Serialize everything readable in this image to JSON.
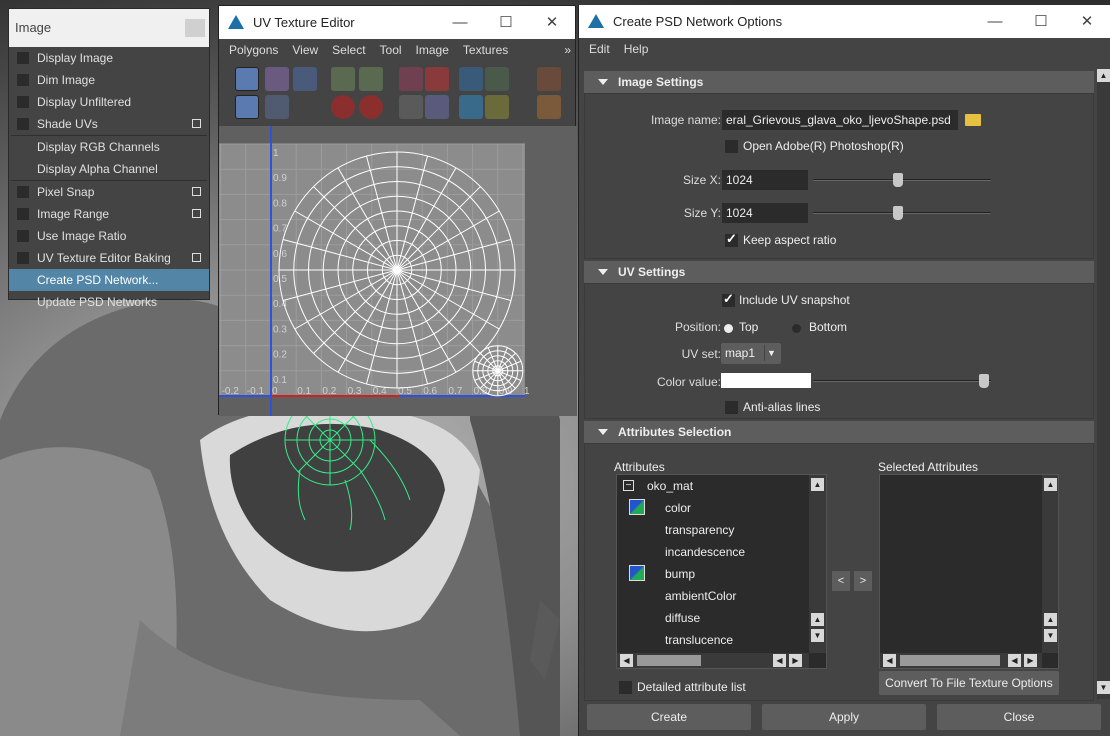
{
  "image_menu": {
    "title": "Image",
    "items": [
      {
        "label": "Display Image",
        "checkbox": true,
        "option": false
      },
      {
        "label": "Dim Image",
        "checkbox": true,
        "option": false
      },
      {
        "label": "Display Unfiltered",
        "checkbox": true,
        "option": false
      },
      {
        "label": "Shade UVs",
        "checkbox": true,
        "option": true
      },
      {
        "label": "Display RGB Channels",
        "checkbox": false,
        "option": false
      },
      {
        "label": "Display Alpha Channel",
        "checkbox": false,
        "option": false
      },
      {
        "label": "Pixel Snap",
        "checkbox": true,
        "option": true
      },
      {
        "label": "Image Range",
        "checkbox": true,
        "option": true
      },
      {
        "label": "Use Image Ratio",
        "checkbox": true,
        "option": false
      },
      {
        "label": "UV Texture Editor Baking",
        "checkbox": true,
        "option": true
      },
      {
        "label": "Create PSD Network...",
        "checkbox": false,
        "option": false,
        "selected": true
      },
      {
        "label": "Update PSD Networks",
        "checkbox": false,
        "option": false
      }
    ]
  },
  "uv_editor": {
    "title": "UV Texture Editor",
    "menus": [
      "Polygons",
      "View",
      "Select",
      "Tool",
      "Image",
      "Textures"
    ],
    "overflow": "»",
    "y_ticks": [
      "1",
      "0.9",
      "0.8",
      "0.7",
      "0.6",
      "0.5",
      "0.4",
      "0.3",
      "0.2",
      "0.1"
    ],
    "x_ticks": [
      "-0.2",
      "-0.1",
      "0",
      "0.1",
      "0.2",
      "0.3",
      "0.4",
      "0.5",
      "0.6",
      "0.7",
      "0.8",
      "0.9",
      "1"
    ]
  },
  "psd_window": {
    "title": "Create PSD Network Options",
    "menus": [
      "Edit",
      "Help"
    ],
    "image_settings": {
      "header": "Image Settings",
      "image_name_label": "Image name:",
      "image_name_value": "eral_Grievous_glava_oko_ljevoShape.psd",
      "open_photoshop_label": "Open Adobe(R) Photoshop(R)",
      "open_photoshop_checked": false,
      "size_x_label": "Size X:",
      "size_x_value": "1024",
      "size_y_label": "Size Y:",
      "size_y_value": "1024",
      "keep_aspect_label": "Keep aspect ratio",
      "keep_aspect_checked": true
    },
    "uv_settings": {
      "header": "UV Settings",
      "include_snapshot_label": "Include UV snapshot",
      "include_snapshot_checked": true,
      "position_label": "Position:",
      "position_options": [
        "Top",
        "Bottom"
      ],
      "position_selected": "Top",
      "uv_set_label": "UV set:",
      "uv_set_value": "map1",
      "color_value_label": "Color value:",
      "color_value": "#ffffff",
      "anti_alias_label": "Anti-alias lines",
      "anti_alias_checked": false
    },
    "attributes_selection": {
      "header": "Attributes Selection",
      "attributes_label": "Attributes",
      "selected_label": "Selected Attributes",
      "root_node": "oko_mat",
      "attributes": [
        {
          "name": "color",
          "icon": true
        },
        {
          "name": "transparency",
          "icon": false
        },
        {
          "name": "incandescence",
          "icon": false
        },
        {
          "name": "bump",
          "icon": true
        },
        {
          "name": "ambientColor",
          "icon": false
        },
        {
          "name": "diffuse",
          "icon": false
        },
        {
          "name": "translucence",
          "icon": false
        }
      ],
      "move_left": "<",
      "move_right": ">",
      "detailed_list_label": "Detailed attribute list",
      "convert_button": "Convert To File Texture Options"
    },
    "buttons": {
      "create": "Create",
      "apply": "Apply",
      "close": "Close"
    }
  },
  "window_controls": {
    "minimize": "—",
    "maximize": "☐",
    "close": "✕"
  },
  "colors": {
    "menu_highlight": "#5285a6",
    "uv_axis_blue": "#3050e0",
    "uv_axis_red": "#cc2222",
    "uv_wire": "#ffffff",
    "mesh_wire": "#33ee88"
  }
}
